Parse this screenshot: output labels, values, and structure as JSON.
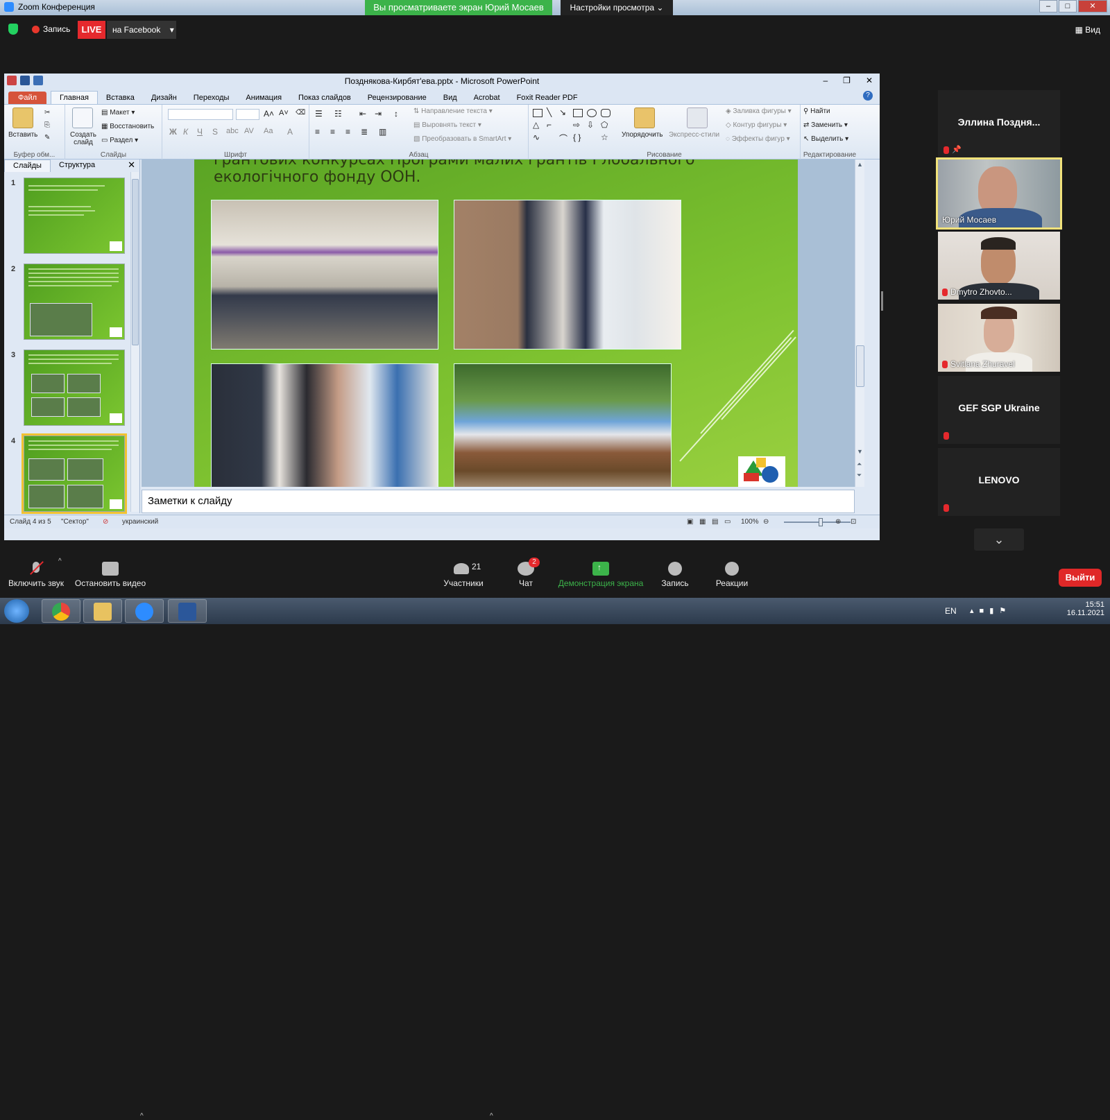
{
  "zoom": {
    "window_title": "Zoom Конференция",
    "share_banner": "Вы просматриваете экран Юрий Мосаев",
    "view_options": "Настройки просмотра",
    "record_label": "Запись",
    "live_badge": "LIVE",
    "facebook_label": "на Facebook",
    "view_label": "Вид"
  },
  "ppt": {
    "title": "Позднякова-Кирбят'ева.pptx - Microsoft PowerPoint",
    "tabs": [
      "Файл",
      "Главная",
      "Вставка",
      "Дизайн",
      "Переходы",
      "Анимация",
      "Показ слайдов",
      "Рецензирование",
      "Вид",
      "Acrobat",
      "Foxit Reader PDF"
    ],
    "active_tab": "Главная",
    "ribbon": {
      "paste": "Вставить",
      "clipboard_group": "Буфер обм...",
      "new_slide": "Создать слайд",
      "layout": "Макет",
      "reset": "Восстановить",
      "section": "Раздел",
      "slides_group": "Слайды",
      "font_group": "Шрифт",
      "paragraph_group": "Абзац",
      "text_direction": "Направление текста",
      "align_text": "Выровнять текст",
      "smartart": "Преобразовать в SmartArt",
      "arrange": "Упорядочить",
      "quick_styles": "Экспресс-стили",
      "shape_fill": "Заливка фигуры",
      "shape_outline": "Контур фигуры",
      "shape_effects": "Эффекты фигур",
      "drawing_group": "Рисование",
      "find": "Найти",
      "replace": "Заменить",
      "select": "Выделить",
      "editing_group": "Редактирование"
    },
    "pane_tabs": [
      "Слайды",
      "Структура"
    ],
    "thumbs": [
      "1",
      "2",
      "3",
      "4"
    ],
    "slide_heading": "грантових конкурсах Програми малих грантів Глобального екологічного фонду ООН.",
    "notes": "Заметки к слайду",
    "status": {
      "slide": "Слайд 4 из 5",
      "theme": "\"Сектор\"",
      "language": "украинский",
      "zoom": "100%"
    }
  },
  "gallery": [
    {
      "name": "Эллина  Поздня...",
      "video": false
    },
    {
      "name": "Юрий Мосаев",
      "video": true,
      "active": true
    },
    {
      "name": "Dmytro Zhovto...",
      "video": true
    },
    {
      "name": "Svitlana Zhuravel",
      "video": true
    },
    {
      "name": "GEF SGP Ukraine",
      "video": false
    },
    {
      "name": "LENOVO",
      "video": false
    }
  ],
  "toolbar": {
    "unmute": "Включить звук",
    "stop_video": "Остановить видео",
    "participants": "Участники",
    "participants_count": "21",
    "chat": "Чат",
    "chat_badge": "2",
    "share": "Демонстрация экрана",
    "record": "Запись",
    "reactions": "Реакции",
    "leave": "Выйти"
  },
  "taskbar": {
    "lang": "EN",
    "time": "15:51",
    "date": "16.11.2021"
  },
  "colors": {
    "zoom_green": "#3cb34a",
    "live_red": "#e5292d",
    "slide_green": "#7ec230",
    "active_speaker": "#f1e27a"
  }
}
